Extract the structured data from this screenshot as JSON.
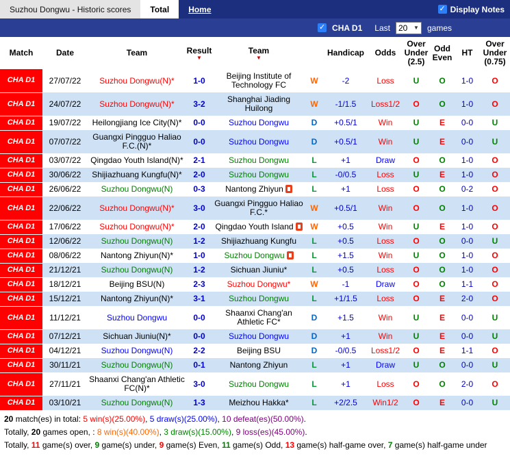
{
  "palette": {
    "navy_bar": "#1b2f7e",
    "filter_bar": "#2a3f94",
    "checkbox_blue": "#2d7ff9",
    "badge_bg": "#ff0000",
    "row_alt": "#cfe2f5",
    "team_win": "#ff0000",
    "team_draw": "#0000ff",
    "team_loss": "#008000",
    "result_w": "#ff6600",
    "result_d": "#0066cc",
    "result_l": "#009933",
    "handicap": "#0000cc",
    "score": "#0000cc",
    "over_red": "#ff0000",
    "under_green": "#008000",
    "odds_draw": "#0000ff"
  },
  "icons": {
    "check": "✓",
    "dropdown_arrow": "▼",
    "sort_arrow": "▼"
  },
  "topbar": {
    "title": "Suzhou Dongwu - Historic scores",
    "tab_total": "Total",
    "tab_home": "Home",
    "display_notes": "Display Notes"
  },
  "filterbar": {
    "league": "CHA D1",
    "last": "Last",
    "count": "20",
    "games": "games"
  },
  "table": {
    "headers": {
      "match": "Match",
      "date": "Date",
      "team_home": "Team",
      "result": "Result",
      "team_away": "Team",
      "handicap": "Handicap",
      "odds": "Odds",
      "over_under_25": "Over Under (2.5)",
      "odd_even": "Odd Even",
      "ht": "HT",
      "over_under_075": "Over Under (0.75)"
    },
    "rows": [
      {
        "league": "CHA D1",
        "date": "27/07/22",
        "home": "Suzhou Dongwu(N)*",
        "home_color": "win",
        "home_icon": false,
        "score": "1-0",
        "away": "Beijing Institute of Technology FC",
        "away_color": "none",
        "away_icon": false,
        "result": "W",
        "handicap": "-2",
        "odds": "Loss",
        "over_under_25": "U",
        "odd_even": "O",
        "ht": "1-0",
        "over_under_075": "O"
      },
      {
        "league": "CHA D1",
        "date": "24/07/22",
        "home": "Suzhou Dongwu(N)*",
        "home_color": "win",
        "home_icon": false,
        "score": "3-2",
        "away": "Shanghai Jiading Huilong",
        "away_color": "none",
        "away_icon": false,
        "result": "W",
        "handicap": "-1/1.5",
        "odds": "Loss1/2",
        "over_under_25": "O",
        "odd_even": "O",
        "ht": "1-0",
        "over_under_075": "O"
      },
      {
        "league": "CHA D1",
        "date": "19/07/22",
        "home": "Heilongjiang Ice City(N)*",
        "home_color": "none",
        "home_icon": false,
        "score": "0-0",
        "away": "Suzhou Dongwu",
        "away_color": "draw",
        "away_icon": false,
        "result": "D",
        "handicap": "+0.5/1",
        "odds": "Win",
        "over_under_25": "U",
        "odd_even": "E",
        "ht": "0-0",
        "over_under_075": "U"
      },
      {
        "league": "CHA D1",
        "date": "07/07/22",
        "home": "Guangxi Pingguo Haliao F.C.(N)*",
        "home_color": "none",
        "home_icon": false,
        "score": "0-0",
        "away": "Suzhou Dongwu",
        "away_color": "draw",
        "away_icon": false,
        "result": "D",
        "handicap": "+0.5/1",
        "odds": "Win",
        "over_under_25": "U",
        "odd_even": "E",
        "ht": "0-0",
        "over_under_075": "U"
      },
      {
        "league": "CHA D1",
        "date": "03/07/22",
        "home": "Qingdao Youth Island(N)*",
        "home_color": "none",
        "home_icon": false,
        "score": "2-1",
        "away": "Suzhou Dongwu",
        "away_color": "loss",
        "away_icon": false,
        "result": "L",
        "handicap": "+1",
        "odds": "Draw",
        "over_under_25": "O",
        "odd_even": "O",
        "ht": "1-0",
        "over_under_075": "O"
      },
      {
        "league": "CHA D1",
        "date": "30/06/22",
        "home": "Shijiazhuang Kungfu(N)*",
        "home_color": "none",
        "home_icon": false,
        "score": "2-0",
        "away": "Suzhou Dongwu",
        "away_color": "loss",
        "away_icon": false,
        "result": "L",
        "handicap": "-0/0.5",
        "odds": "Loss",
        "over_under_25": "U",
        "odd_even": "E",
        "ht": "1-0",
        "over_under_075": "O"
      },
      {
        "league": "CHA D1",
        "date": "26/06/22",
        "home": "Suzhou Dongwu(N)",
        "home_color": "loss",
        "home_icon": false,
        "score": "0-3",
        "away": "Nantong Zhiyun",
        "away_color": "none",
        "away_icon": true,
        "result": "L",
        "handicap": "+1",
        "odds": "Loss",
        "over_under_25": "O",
        "odd_even": "O",
        "ht": "0-2",
        "over_under_075": "O"
      },
      {
        "league": "CHA D1",
        "date": "22/06/22",
        "home": "Suzhou Dongwu(N)*",
        "home_color": "win",
        "home_icon": false,
        "score": "3-0",
        "away": "Guangxi Pingguo Haliao F.C.*",
        "away_color": "none",
        "away_icon": false,
        "result": "W",
        "handicap": "+0.5/1",
        "odds": "Win",
        "over_under_25": "O",
        "odd_even": "O",
        "ht": "1-0",
        "over_under_075": "O"
      },
      {
        "league": "CHA D1",
        "date": "17/06/22",
        "home": "Suzhou Dongwu(N)*",
        "home_color": "win",
        "home_icon": false,
        "score": "2-0",
        "away": "Qingdao Youth Island",
        "away_color": "none",
        "away_icon": true,
        "result": "W",
        "handicap": "+0.5",
        "odds": "Win",
        "over_under_25": "U",
        "odd_even": "E",
        "ht": "1-0",
        "over_under_075": "O"
      },
      {
        "league": "CHA D1",
        "date": "12/06/22",
        "home": "Suzhou Dongwu(N)",
        "home_color": "loss",
        "home_icon": false,
        "score": "1-2",
        "away": "Shijiazhuang Kungfu",
        "away_color": "none",
        "away_icon": false,
        "result": "L",
        "handicap": "+0.5",
        "odds": "Loss",
        "over_under_25": "O",
        "odd_even": "O",
        "ht": "0-0",
        "over_under_075": "U"
      },
      {
        "league": "CHA D1",
        "date": "08/06/22",
        "home": "Nantong Zhiyun(N)*",
        "home_color": "none",
        "home_icon": false,
        "score": "1-0",
        "away": "Suzhou Dongwu",
        "away_color": "loss",
        "away_icon": true,
        "result": "L",
        "handicap": "+1.5",
        "odds": "Win",
        "over_under_25": "U",
        "odd_even": "O",
        "ht": "1-0",
        "over_under_075": "O"
      },
      {
        "league": "CHA D1",
        "date": "21/12/21",
        "home": "Suzhou Dongwu(N)",
        "home_color": "loss",
        "home_icon": false,
        "score": "1-2",
        "away": "Sichuan Jiuniu*",
        "away_color": "none",
        "away_icon": false,
        "result": "L",
        "handicap": "+0.5",
        "odds": "Loss",
        "over_under_25": "O",
        "odd_even": "O",
        "ht": "1-0",
        "over_under_075": "O"
      },
      {
        "league": "CHA D1",
        "date": "18/12/21",
        "home": "Beijing BSU(N)",
        "home_color": "none",
        "home_icon": false,
        "score": "2-3",
        "away": "Suzhou Dongwu*",
        "away_color": "win",
        "away_icon": false,
        "result": "W",
        "handicap": "-1",
        "odds": "Draw",
        "over_under_25": "O",
        "odd_even": "O",
        "ht": "1-1",
        "over_under_075": "O"
      },
      {
        "league": "CHA D1",
        "date": "15/12/21",
        "home": "Nantong Zhiyun(N)*",
        "home_color": "none",
        "home_icon": false,
        "score": "3-1",
        "away": "Suzhou Dongwu",
        "away_color": "loss",
        "away_icon": false,
        "result": "L",
        "handicap": "+1/1.5",
        "odds": "Loss",
        "over_under_25": "O",
        "odd_even": "E",
        "ht": "2-0",
        "over_under_075": "O"
      },
      {
        "league": "CHA D1",
        "date": "11/12/21",
        "home": "Suzhou Dongwu",
        "home_color": "draw",
        "home_icon": false,
        "score": "0-0",
        "away": "Shaanxi Chang'an Athletic FC*",
        "away_color": "none",
        "away_icon": false,
        "result": "D",
        "handicap": "+1.5",
        "odds": "Win",
        "over_under_25": "U",
        "odd_even": "E",
        "ht": "0-0",
        "over_under_075": "U"
      },
      {
        "league": "CHA D1",
        "date": "07/12/21",
        "home": "Sichuan Jiuniu(N)*",
        "home_color": "none",
        "home_icon": false,
        "score": "0-0",
        "away": "Suzhou Dongwu",
        "away_color": "draw",
        "away_icon": false,
        "result": "D",
        "handicap": "+1",
        "odds": "Win",
        "over_under_25": "U",
        "odd_even": "E",
        "ht": "0-0",
        "over_under_075": "U"
      },
      {
        "league": "CHA D1",
        "date": "04/12/21",
        "home": "Suzhou Dongwu(N)",
        "home_color": "draw",
        "home_icon": false,
        "score": "2-2",
        "away": "Beijing BSU",
        "away_color": "none",
        "away_icon": false,
        "result": "D",
        "handicap": "-0/0.5",
        "odds": "Loss1/2",
        "over_under_25": "O",
        "odd_even": "E",
        "ht": "1-1",
        "over_under_075": "O"
      },
      {
        "league": "CHA D1",
        "date": "30/11/21",
        "home": "Suzhou Dongwu(N)",
        "home_color": "loss",
        "home_icon": false,
        "score": "0-1",
        "away": "Nantong Zhiyun",
        "away_color": "none",
        "away_icon": false,
        "result": "L",
        "handicap": "+1",
        "odds": "Draw",
        "over_under_25": "U",
        "odd_even": "O",
        "ht": "0-0",
        "over_under_075": "U"
      },
      {
        "league": "CHA D1",
        "date": "27/11/21",
        "home": "Shaanxi Chang'an Athletic FC(N)*",
        "home_color": "none",
        "home_icon": false,
        "score": "3-0",
        "away": "Suzhou Dongwu",
        "away_color": "loss",
        "away_icon": false,
        "result": "L",
        "handicap": "+1",
        "odds": "Loss",
        "over_under_25": "O",
        "odd_even": "O",
        "ht": "2-0",
        "over_under_075": "O"
      },
      {
        "league": "CHA D1",
        "date": "03/10/21",
        "home": "Suzhou Dongwu(N)",
        "home_color": "loss",
        "home_icon": false,
        "score": "1-3",
        "away": "Meizhou Hakka*",
        "away_color": "none",
        "away_icon": false,
        "result": "L",
        "handicap": "+2/2.5",
        "odds": "Win1/2",
        "over_under_25": "O",
        "odd_even": "E",
        "ht": "0-0",
        "over_under_075": "U"
      }
    ]
  },
  "footer": {
    "lines": [
      [
        {
          "t": "20",
          "b": 1
        },
        {
          "t": " match(es) in total: "
        },
        {
          "t": "5 win(s)(25.00%)",
          "c": "#ff0000"
        },
        {
          "t": ", "
        },
        {
          "t": "5 draw(s)(25.00%)",
          "c": "#0000ff"
        },
        {
          "t": ", "
        },
        {
          "t": "10 defeat(es)(50.00%)",
          "c": "#800080"
        },
        {
          "t": "."
        }
      ],
      [
        {
          "t": "Totally, "
        },
        {
          "t": "20",
          "b": 1
        },
        {
          "t": " games open, : "
        },
        {
          "t": "8 win(s)(40.00%)",
          "c": "#ff6600"
        },
        {
          "t": ", "
        },
        {
          "t": "3 draw(s)(15.00%)",
          "c": "#008000"
        },
        {
          "t": ", "
        },
        {
          "t": "9 loss(es)(45.00%)",
          "c": "#800080"
        },
        {
          "t": "."
        }
      ],
      [
        {
          "t": "Totally, "
        },
        {
          "t": "11",
          "c": "#ff0000",
          "b": 1
        },
        {
          "t": " game(s) over, "
        },
        {
          "t": "9",
          "c": "#008000",
          "b": 1
        },
        {
          "t": " game(s) under, "
        },
        {
          "t": "9",
          "c": "#ff0000",
          "b": 1
        },
        {
          "t": " game(s) Even, "
        },
        {
          "t": "11",
          "c": "#008000",
          "b": 1
        },
        {
          "t": " game(s) Odd, "
        },
        {
          "t": "13",
          "c": "#ff0000",
          "b": 1
        },
        {
          "t": " game(s) half-game over, "
        },
        {
          "t": "7",
          "c": "#008000",
          "b": 1
        },
        {
          "t": " game(s) half-game under"
        }
      ]
    ]
  }
}
